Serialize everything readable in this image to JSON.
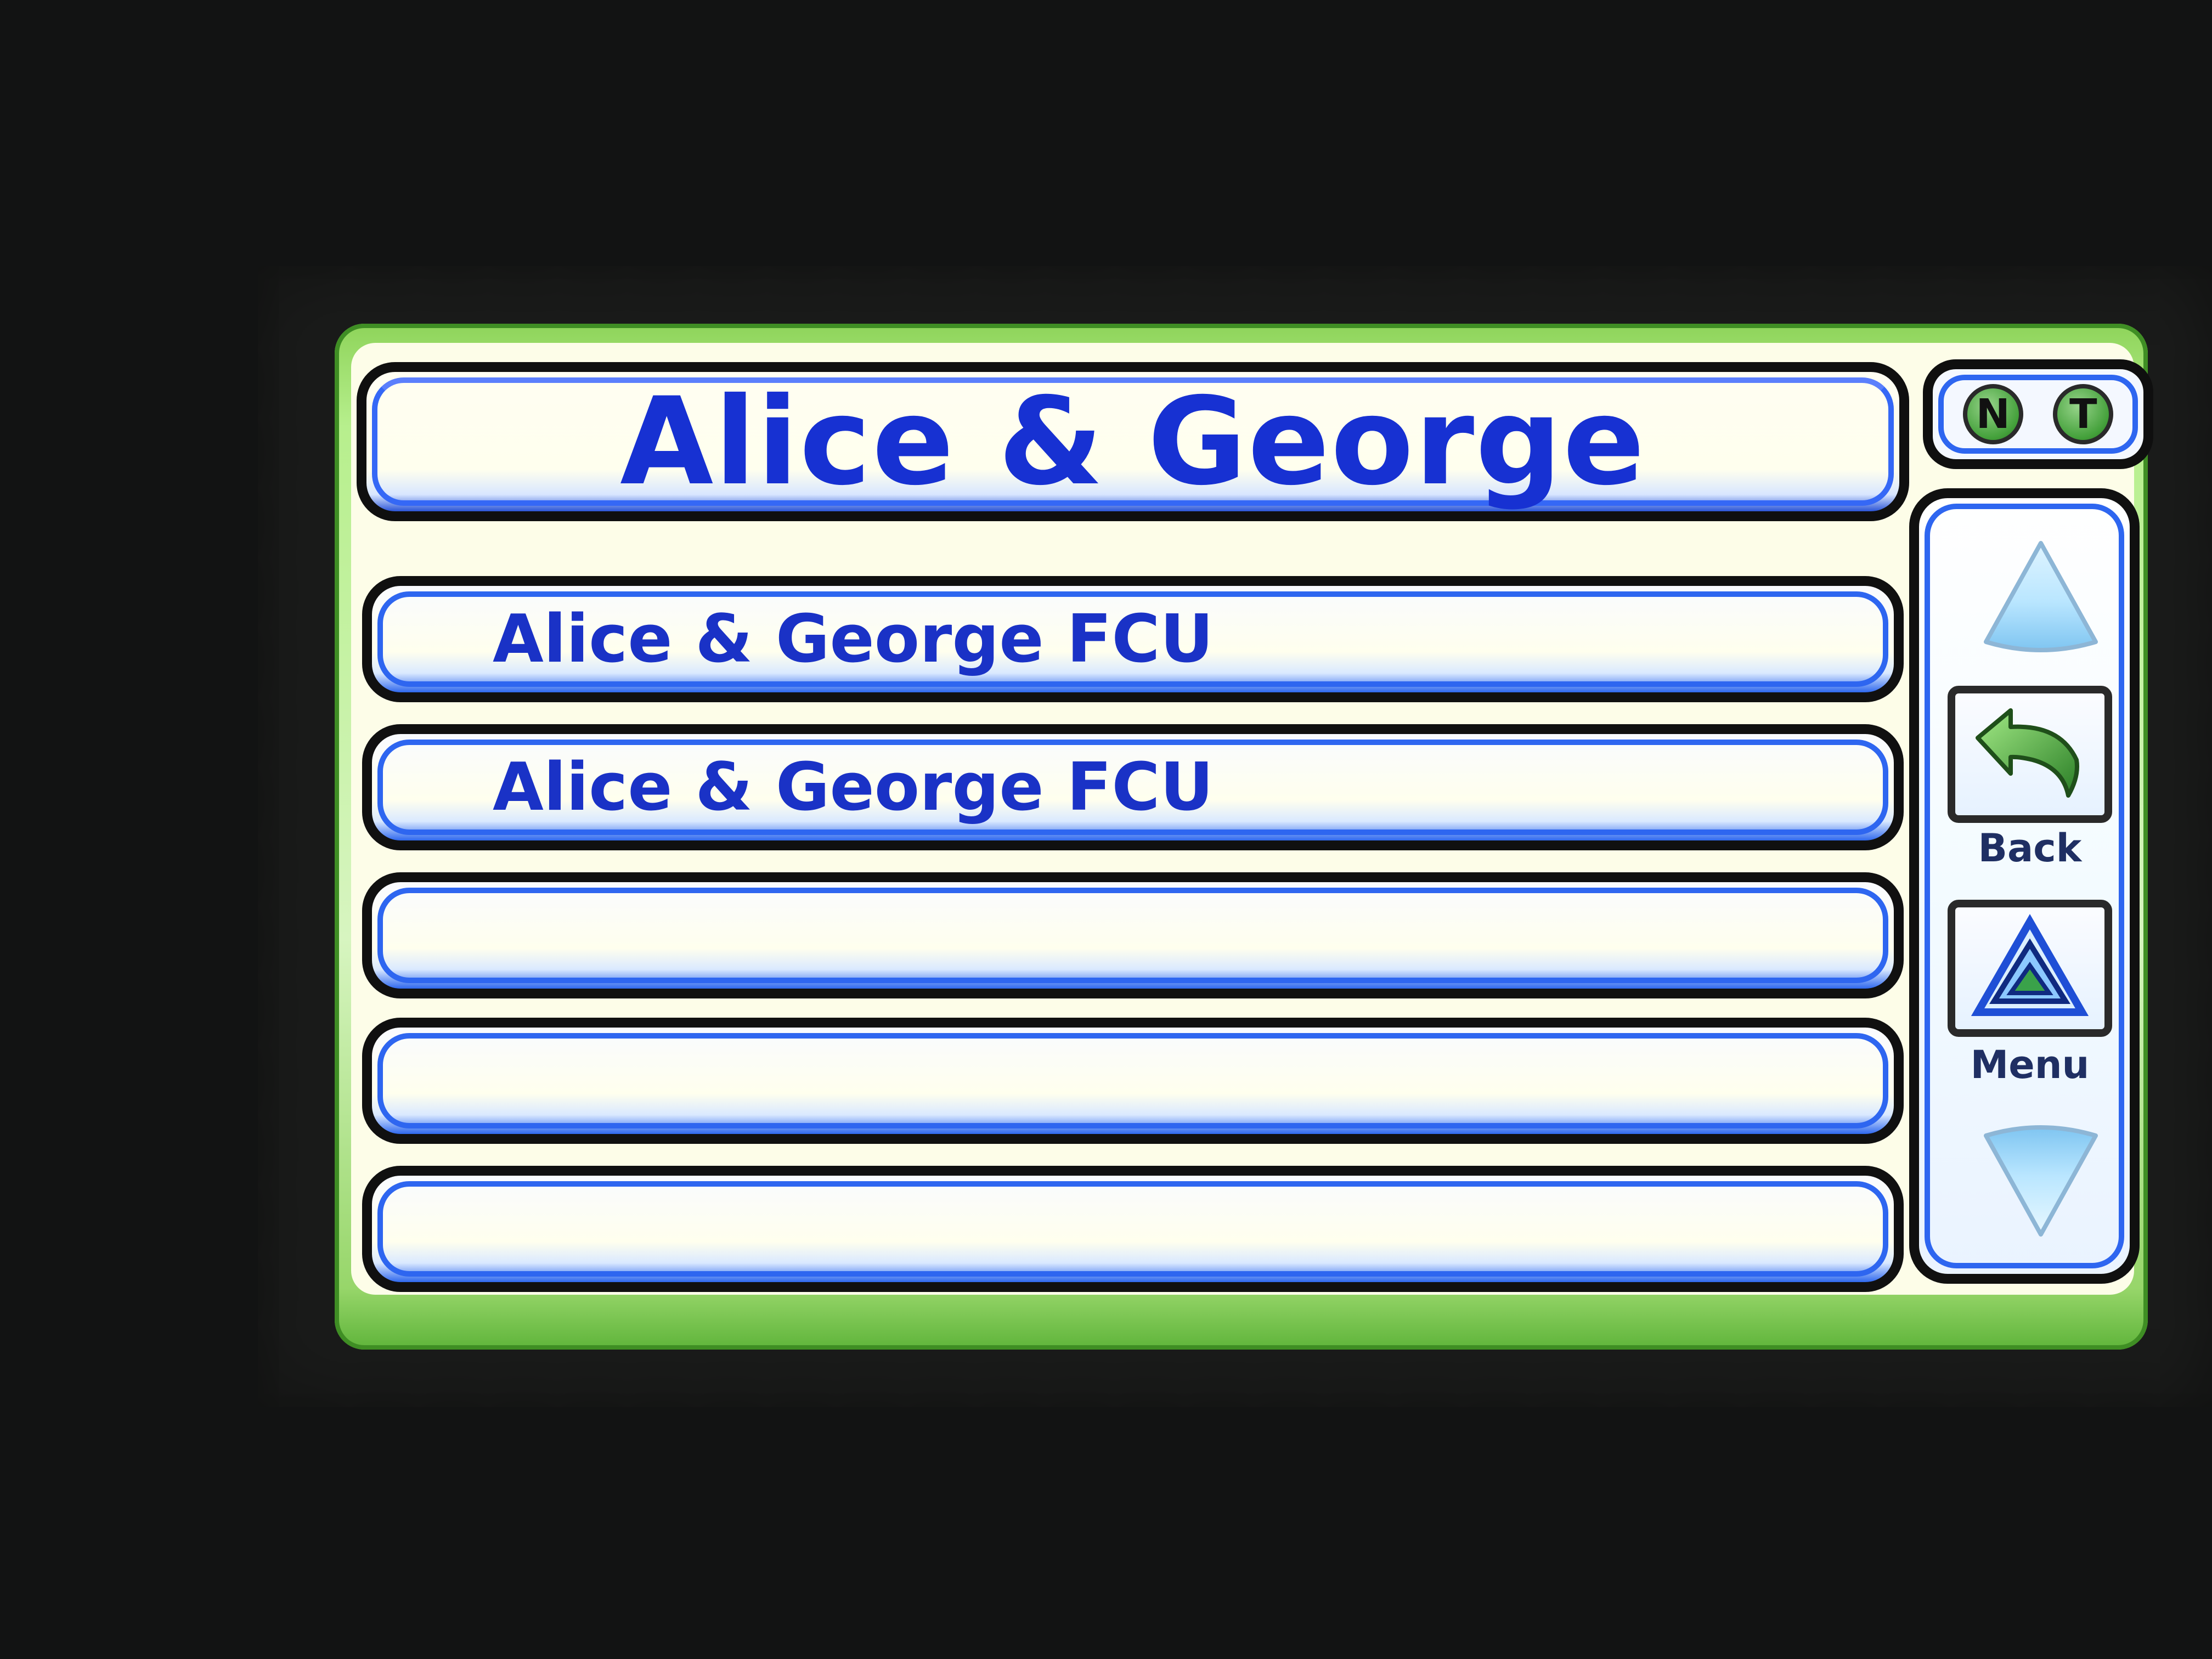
{
  "title": "Alice & George",
  "list": {
    "items": [
      {
        "label": "Alice & George FCU"
      },
      {
        "label": "Alice & George FCU"
      },
      {
        "label": ""
      },
      {
        "label": ""
      },
      {
        "label": ""
      }
    ]
  },
  "indicators": {
    "n": "N",
    "t": "T"
  },
  "side": {
    "back_label": "Back",
    "menu_label": "Menu"
  },
  "icons": {
    "scroll_up": "up-triangle-icon",
    "scroll_down": "down-triangle-icon",
    "back": "back-arrow-icon",
    "menu": "menu-icon"
  },
  "colors": {
    "screen_green": "#8ed45a",
    "panel_blue": "#2e66f0",
    "title_text": "#1731d2"
  }
}
